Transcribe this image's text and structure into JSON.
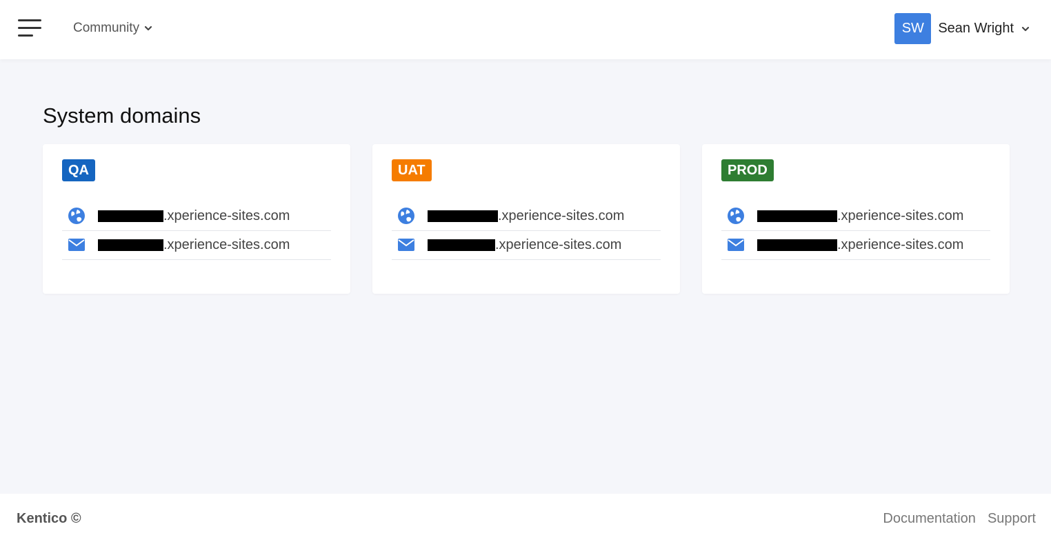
{
  "header": {
    "project_label": "Community",
    "user_initials": "SW",
    "user_name": "Sean Wright",
    "accent_color": "#3d7fe0"
  },
  "page": {
    "title": "System domains"
  },
  "environments": [
    {
      "badge": "QA",
      "badge_color": "#1565c0",
      "rows": [
        {
          "icon": "globe-icon",
          "domain": ".xperience-sites.com"
        },
        {
          "icon": "envelope-icon",
          "domain": ".xperience-sites.com"
        }
      ]
    },
    {
      "badge": "UAT",
      "badge_color": "#f57c00",
      "rows": [
        {
          "icon": "globe-icon",
          "domain": ".xperience-sites.com"
        },
        {
          "icon": "envelope-icon",
          "domain": ".xperience-sites.com"
        }
      ]
    },
    {
      "badge": "PROD",
      "badge_color": "#2e7d32",
      "rows": [
        {
          "icon": "globe-icon",
          "domain": ".xperience-sites.com"
        },
        {
          "icon": "envelope-icon",
          "domain": ".xperience-sites.com"
        }
      ]
    }
  ],
  "footer": {
    "brand": "Kentico ©",
    "links": [
      "Documentation",
      "Support"
    ]
  }
}
